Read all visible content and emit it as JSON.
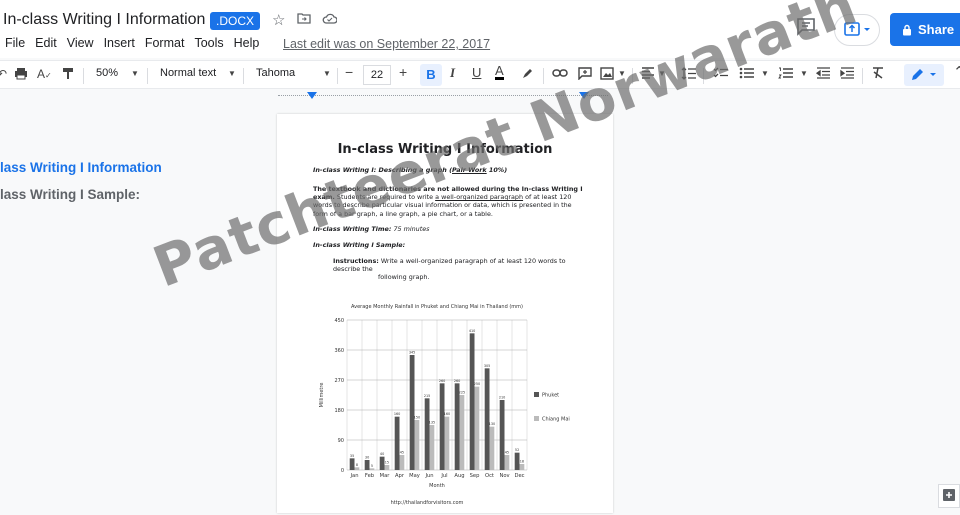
{
  "header": {
    "title": "In-class Writing I Information",
    "badge": ".DOCX",
    "menu": [
      "File",
      "Edit",
      "View",
      "Insert",
      "Format",
      "Tools",
      "Help"
    ],
    "last_edit": "Last edit was on September 22, 2017",
    "share_label": "Share"
  },
  "toolbar": {
    "zoom": "50%",
    "style": "Normal text",
    "font": "Tahoma",
    "font_size": "22"
  },
  "outline": {
    "item1": "lass Writing I Information",
    "item2": "lass Writing I Sample:"
  },
  "document": {
    "title": "In-class Writing I Information",
    "line1_label": "In-class Writing I:  Describing a graph (",
    "line1_underlined": "Pair Work",
    "line1_end": " 10%)",
    "para_bold": "The textbook and dictionaries are not allowed during the In-class Writing I exam.",
    "para_mid": " Students are required to write ",
    "para_underlined": "a well-organized paragraph",
    "para_end": " of at least 120 words to describe particular visual information or data, which is presented in the form of a bar graph, a line graph, a pie chart, or a table.",
    "time_label": "In-class Writing Time:",
    "time_value": "  75 minutes",
    "sample_label": "In-class Writing I Sample:",
    "instructions_label": "Instructions:",
    "instructions_text": " Write a well-organized paragraph of at least 120 words to describe the",
    "instructions_text2": "following graph."
  },
  "chart_data": {
    "type": "bar",
    "title": "Average Monthly Rainfall in Phuket and Chiang Mai in Thailand (mm)",
    "xlabel": "Month",
    "ylabel": "Millimetre",
    "ylim": [
      0,
      450
    ],
    "yticks": [
      0,
      90,
      180,
      270,
      360,
      450
    ],
    "categories": [
      "Jan",
      "Feb",
      "Mar",
      "Apr",
      "May",
      "Jun",
      "Jul",
      "Aug",
      "Sep",
      "Oct",
      "Nov",
      "Dec"
    ],
    "series": [
      {
        "name": "Phuket",
        "color": "#555555",
        "values": [
          35,
          30,
          40,
          160,
          345,
          215,
          260,
          260,
          410,
          305,
          210,
          52
        ]
      },
      {
        "name": "Chiang Mai",
        "color": "#bbbbbb",
        "values": [
          8,
          5,
          15,
          45,
          150,
          135,
          160,
          225,
          250,
          130,
          45,
          18
        ]
      }
    ],
    "source": "http://thailandforvisitors.com",
    "legend": "right",
    "grid": true
  },
  "watermark": "Patchteerat Norwarath",
  "colors": {
    "accent": "#1a73e8"
  }
}
